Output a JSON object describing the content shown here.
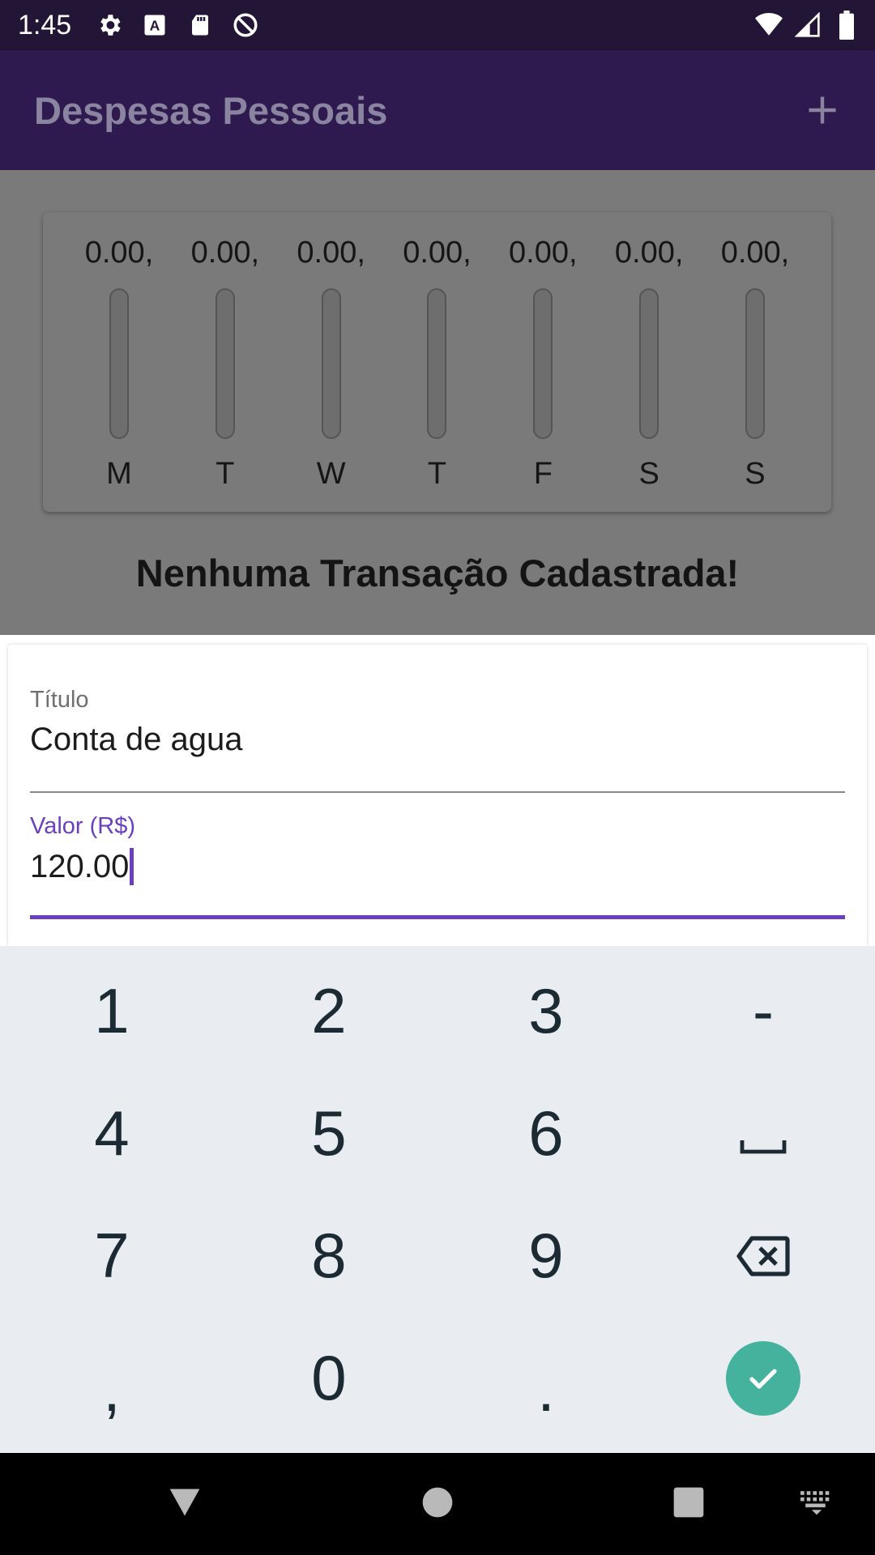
{
  "status_bar": {
    "time": "1:45",
    "left_icons": [
      "gear-icon",
      "a-box-icon",
      "sd-card-icon",
      "no-sync-icon"
    ],
    "right_icons": [
      "wifi-icon",
      "signal-icon",
      "battery-icon"
    ]
  },
  "app_bar": {
    "title": "Despesas Pessoais",
    "add_icon": "plus-icon"
  },
  "chart": {
    "days": [
      {
        "label": "M",
        "amount": "0.00,",
        "fraction": 0
      },
      {
        "label": "T",
        "amount": "0.00,",
        "fraction": 0
      },
      {
        "label": "W",
        "amount": "0.00,",
        "fraction": 0
      },
      {
        "label": "T",
        "amount": "0.00,",
        "fraction": 0
      },
      {
        "label": "F",
        "amount": "0.00,",
        "fraction": 0
      },
      {
        "label": "S",
        "amount": "0.00,",
        "fraction": 0
      },
      {
        "label": "S",
        "amount": "0.00,",
        "fraction": 0
      }
    ]
  },
  "empty_message": "Nenhuma Transação Cadastrada!",
  "form": {
    "title_field": {
      "label": "Título",
      "value": "Conta de agua"
    },
    "value_field": {
      "label": "Valor (R$)",
      "value": "120.00"
    }
  },
  "keyboard": {
    "keys": [
      "1",
      "2",
      "3",
      "-",
      "4",
      "5",
      "6",
      "space",
      "7",
      "8",
      "9",
      "backspace",
      ",",
      "0",
      ".",
      "enter"
    ]
  },
  "nav_bar": {
    "icons": [
      "back-icon",
      "home-icon",
      "recents-icon",
      "keyboard-icon"
    ]
  },
  "colors": {
    "accent": "#6a3fc0",
    "app_bar": "#2e1a4f",
    "status_bar": "#231536",
    "enter": "#45b29d"
  }
}
